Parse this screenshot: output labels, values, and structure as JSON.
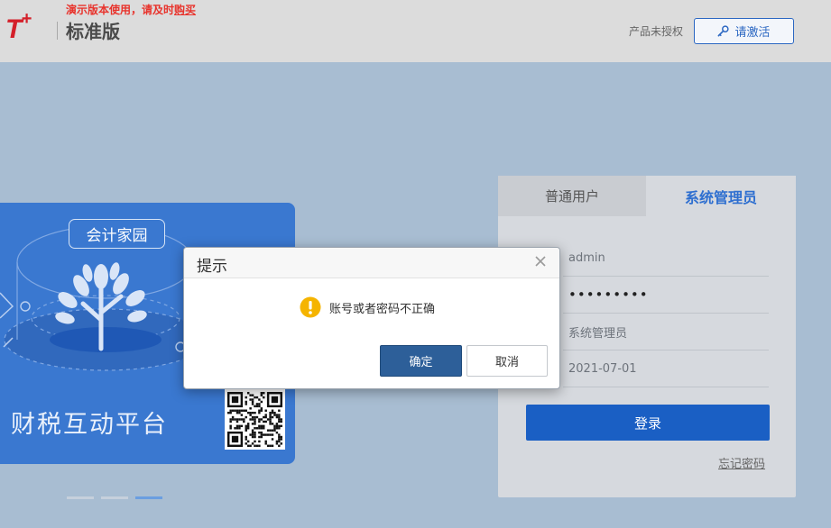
{
  "header": {
    "logo_text": "T",
    "logo_plus": "+",
    "demo_notice_prefix": "演示版本使用，请及时",
    "demo_notice_link": "购买",
    "edition": "标准版",
    "unlicensed": "产品未授权",
    "activate_label": "请激活"
  },
  "banner": {
    "tag": "会计家园",
    "title": "财税互动平台",
    "slides": [
      {
        "active": false
      },
      {
        "active": false
      },
      {
        "active": true
      }
    ]
  },
  "login": {
    "tabs": [
      {
        "label": "普通用户",
        "active": false
      },
      {
        "label": "系统管理员",
        "active": true
      }
    ],
    "username": "admin",
    "password_mask": "•••••••••",
    "role": "系统管理员",
    "date": "2021-07-01",
    "submit_label": "登录",
    "forgot_label": "忘记密码"
  },
  "dialog": {
    "title": "提示",
    "message": "账号或者密码不正确",
    "ok_label": "确定",
    "cancel_label": "取消"
  },
  "colors": {
    "brand_red": "#d4202a",
    "primary_blue": "#1a5fc4",
    "dialog_ok": "#2d5f99",
    "warning_yellow": "#f5b400"
  },
  "icons": [
    "key-icon",
    "close-icon",
    "warning-icon",
    "qr-code-icon",
    "tree-illustration-icon"
  ]
}
